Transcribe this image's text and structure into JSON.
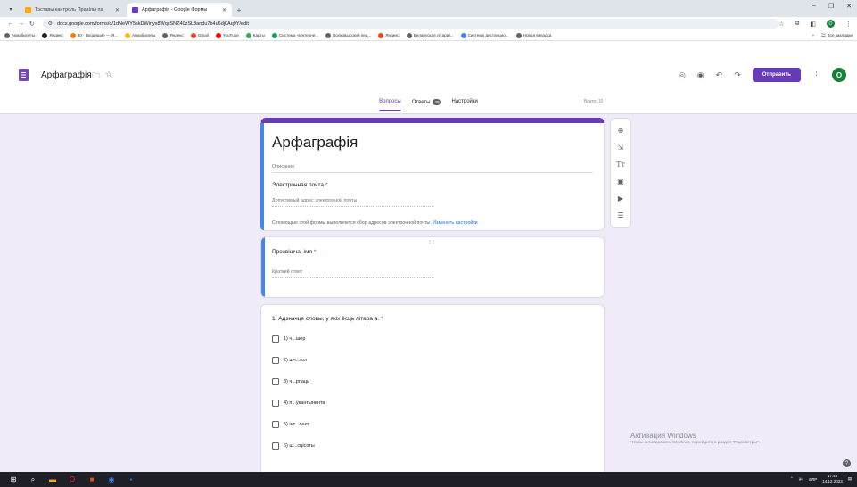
{
  "browser": {
    "tabs": [
      {
        "title": "Тэставы кантроль Правілы па",
        "fav_color": "#f9ab00",
        "active": false
      },
      {
        "title": "Арфаграфія - Google Формы",
        "fav_color": "#673ab7",
        "active": true
      }
    ],
    "new_tab": "+",
    "url": "docs.google.com/forms/d/1dNeWY5skDWinyx8WqcSNZ40zSL8andu7b4u6dj0Aq9Y/edit",
    "bookmarks": [
      {
        "label": "Авиабилеты",
        "color": "#5f6368"
      },
      {
        "label": "Яндекс",
        "color": "#202124"
      },
      {
        "label": "30 · Входящие — Я...",
        "color": "#f57c00"
      },
      {
        "label": "Авиабилеты",
        "color": "#fbbc04"
      },
      {
        "label": "Яндекс",
        "color": "#5f6368"
      },
      {
        "label": "Gmail",
        "color": "#ea4335"
      },
      {
        "label": "YouTube",
        "color": "#ff0000"
      },
      {
        "label": "Карты",
        "color": "#34a853"
      },
      {
        "label": "Система «Интерне...",
        "color": "#0f9d58"
      },
      {
        "label": "Волковысский пед...",
        "color": "#5f6368"
      },
      {
        "label": "Яндекс",
        "color": "#fc3f1d"
      },
      {
        "label": "Беларуская літарат...",
        "color": "#5f6368"
      },
      {
        "label": "Система дистанцио...",
        "color": "#4285f4"
      },
      {
        "label": "Новая вкладка",
        "color": "#5f6368"
      }
    ],
    "bookmarks_overflow": "»",
    "all_bookmarks": "Все закладки",
    "profile_initial": "O"
  },
  "form": {
    "title": "Арфаграфія",
    "send_label": "Отправить",
    "avatar_initial": "O",
    "tabs": {
      "questions": "Вопросы",
      "answers": "Ответы",
      "answers_count": "49",
      "settings": "Настройки"
    },
    "total": "Всего: 10",
    "header_card": {
      "title": "Арфаграфія",
      "description_placeholder": "Описание",
      "email_label": "Электронная почта",
      "email_placeholder": "Допустимый адрес электронной почты",
      "note": "С помощью этой формы выполняется сбор адресов электронной почты.",
      "note_link": "Изменить настройки"
    },
    "q_name": {
      "label": "Прозвішча, імя",
      "placeholder": "Краткий ответ"
    },
    "q1": {
      "label": "1.   Адзначце словы, у якіх ёсць літара а.",
      "options": [
        "1) ч...шер",
        "2) шч...гол",
        "3) ч...рпаць",
        "4) п...ўкантынента",
        "5) інт...лект",
        "6) ш...сцісоты"
      ]
    }
  },
  "watermark": {
    "line1": "Активация Windows",
    "line2": "Чтобы активировать Windows, перейдите в раздел \"Параметры\"."
  },
  "taskbar": {
    "lang": "БЛР",
    "time": "17:45",
    "date": "14.12.2023"
  }
}
